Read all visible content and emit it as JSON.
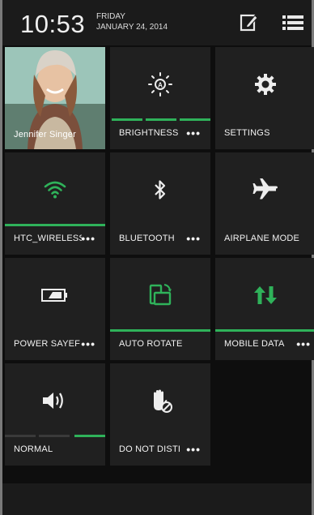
{
  "status": {
    "time": "10:53",
    "day": "FRIDAY",
    "date": "JANUARY 24, 2014"
  },
  "colors": {
    "accent": "#2fb25a",
    "tile": "#202020",
    "background": "#0e0e0e"
  },
  "tiles": [
    {
      "label": "Jennifer Singer",
      "icon": "contact-photo"
    },
    {
      "label": "BRIGHTNESS",
      "more": "•••",
      "icon": "brightness-icon"
    },
    {
      "label": "SETTINGS",
      "icon": "settings-gear-icon"
    },
    {
      "label": "HTC_Wireless",
      "more": "•••",
      "icon": "wifi-icon",
      "active": true
    },
    {
      "label": "BLUETOOTH",
      "more": "•••",
      "icon": "bluetooth-icon"
    },
    {
      "label": "AIRPLANE MODE",
      "icon": "airplane-icon"
    },
    {
      "label": "POWER SAYEF",
      "more": "•••",
      "icon": "battery-icon"
    },
    {
      "label": "AUTO ROTATE",
      "icon": "rotate-icon",
      "active": true
    },
    {
      "label": "MOBILE DATA",
      "more": "•••",
      "icon": "mobile-data-icon",
      "active": true
    },
    {
      "label": "NORMAL",
      "icon": "volume-icon"
    },
    {
      "label": "DO NOT DISTI",
      "more": "•••",
      "icon": "do-not-disturb-icon"
    }
  ]
}
